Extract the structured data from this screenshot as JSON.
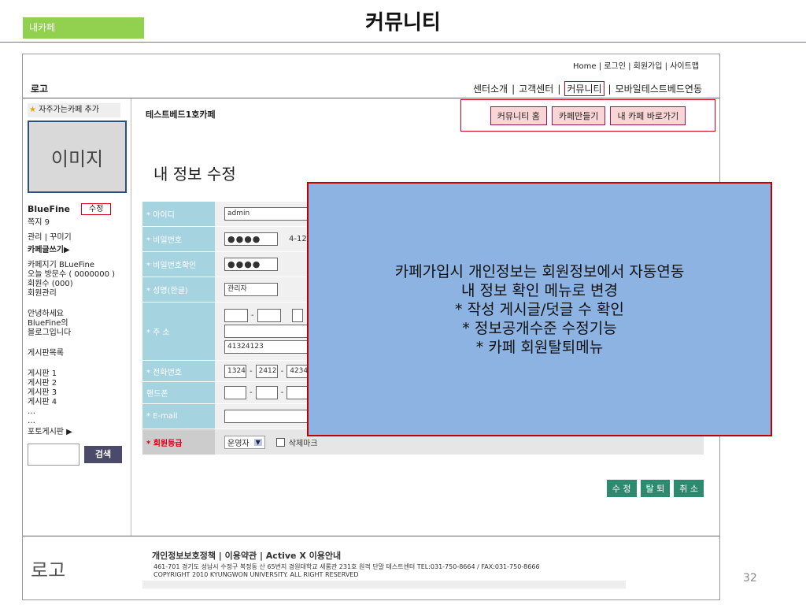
{
  "slide": {
    "tag": "내카페",
    "title": "커뮤니티",
    "page_number": "32"
  },
  "util_links": [
    "Home",
    "로그인",
    "회원가입",
    "사이트맵"
  ],
  "logo_top": "로고",
  "topnav": [
    "센터소개",
    "고객센터",
    "커뮤니티",
    "모바일테스트베드연동"
  ],
  "sidebar": {
    "fav_label": "자주가는카페 추가",
    "image_placeholder": "이미지",
    "nickname": "BlueFine",
    "edit_label": "수정",
    "note": "쪽지 9",
    "manage": "관리 | 꾸미기",
    "write": "카페글쓰기▶",
    "cafe_keeper": "카페지기 BLueFine",
    "today_visits": "오늘 방문수 ( 0000000 )",
    "members": "회원수 (000)",
    "member_manage": "회원관리",
    "greeting1": "안녕하세요",
    "greeting2": "BlueFine의",
    "greeting3": "블로그입니다",
    "board_list": "게시판목록",
    "boards": [
      "게시판 1",
      "게시판 2",
      "게시판 3",
      "게시판 4",
      "…",
      "…"
    ],
    "photo_board": "포토게시판 ▶",
    "search_btn": "검색"
  },
  "main": {
    "cafe_name": "테스트베드1호카페",
    "btn_home": "커뮤니티 홈",
    "btn_make": "카페만들기",
    "btn_go": "내 카페 바로가기",
    "page_title": "내 정보 수정"
  },
  "form": {
    "id_label": "* 아이디",
    "id_value": "admin",
    "pw_label": "* 비밀번호",
    "pw_value": "●●●●",
    "pw_hint": "4-12",
    "pw2_label": "* 비밀번호확인",
    "pw2_value": "●●●●",
    "name_label": "* 성명(한글)",
    "name_value": "관리자",
    "addr_label": "* 주 소",
    "addr_detail": "41324123",
    "phone_label": "* 전화번호",
    "phone1": "1324",
    "phone2": "2412",
    "phone3": "4234",
    "mobile_label": "핸드폰",
    "email_label": "* E-mail",
    "grade_label": "* 회원등급",
    "grade_value": "운영자",
    "delete_mark": "삭제마크"
  },
  "actions": {
    "edit": "수 정",
    "leave": "탈 퇴",
    "cancel": "취 소"
  },
  "popup": {
    "lines": [
      "카페가입시 개인정보는 회원정보에서 자동연동",
      "내 정보 확인 메뉴로 변경",
      "* 작성 게시글/덧글 수 확인",
      "* 정보공개수준 수정기능",
      "* 카페 회원탈퇴메뉴"
    ]
  },
  "footer": {
    "logo": "로고",
    "links": "개인정보보호정책 | 이용약관 | Active X 이용안내",
    "address": "461-701 경기도 성남시 수정구 복정동 산 65번지 경원대학교 새롬관 231호 원격 단말 테스트센터 TEL:031-750-8664 / FAX:031-750-8666",
    "copyright": "COPYRIGHT 2010 KYUNGWON UNIVERSITY. ALL RIGHT RESERVED"
  }
}
